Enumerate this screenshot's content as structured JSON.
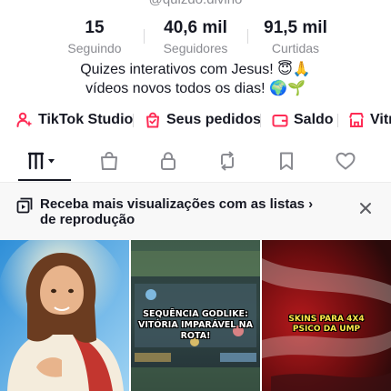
{
  "profile": {
    "handle": "@quizdo.divino",
    "stats": [
      {
        "value": "15",
        "label": "Seguindo"
      },
      {
        "value": "40,6 mil",
        "label": "Seguidores"
      },
      {
        "value": "91,5 mil",
        "label": "Curtidas"
      }
    ],
    "bio_line1": "Quizes interativos com Jesus! 😇🙏",
    "bio_line2": "vídeos novos todos os dias! 🌍🌱"
  },
  "shortcuts": {
    "studio": {
      "label": "TikTok Studio",
      "icon": "person-sparkle-icon"
    },
    "orders": {
      "label": "Seus pedidos",
      "icon": "shopping-bag-icon"
    },
    "balance": {
      "label": "Saldo",
      "icon": "wallet-icon"
    },
    "showcase": {
      "label": "Vitr",
      "icon": "storefront-icon"
    }
  },
  "tabs": [
    {
      "name": "videos-grid",
      "icon": "grid-icon",
      "active": true
    },
    {
      "name": "shop",
      "icon": "shopping-bag-icon"
    },
    {
      "name": "private",
      "icon": "lock-icon"
    },
    {
      "name": "reposts",
      "icon": "repost-icon"
    },
    {
      "name": "favorites",
      "icon": "bookmark-icon"
    },
    {
      "name": "liked",
      "icon": "heart-icon"
    }
  ],
  "banner": {
    "text": "Receba mais visualizações com as listas  ›  de reprodução",
    "icon": "playlist-icon"
  },
  "videos": [
    {
      "caption": ""
    },
    {
      "caption": "SEQUÊNCIA GODLIKE: VITÓRIA IMPARÁVEL NA ROTA!"
    },
    {
      "caption": "SKINS PARA 4X4 PSICO DA UMP"
    }
  ],
  "colors": {
    "accent_red": "#fe2c55",
    "text_primary": "#161823",
    "text_secondary": "#8a8b91"
  }
}
